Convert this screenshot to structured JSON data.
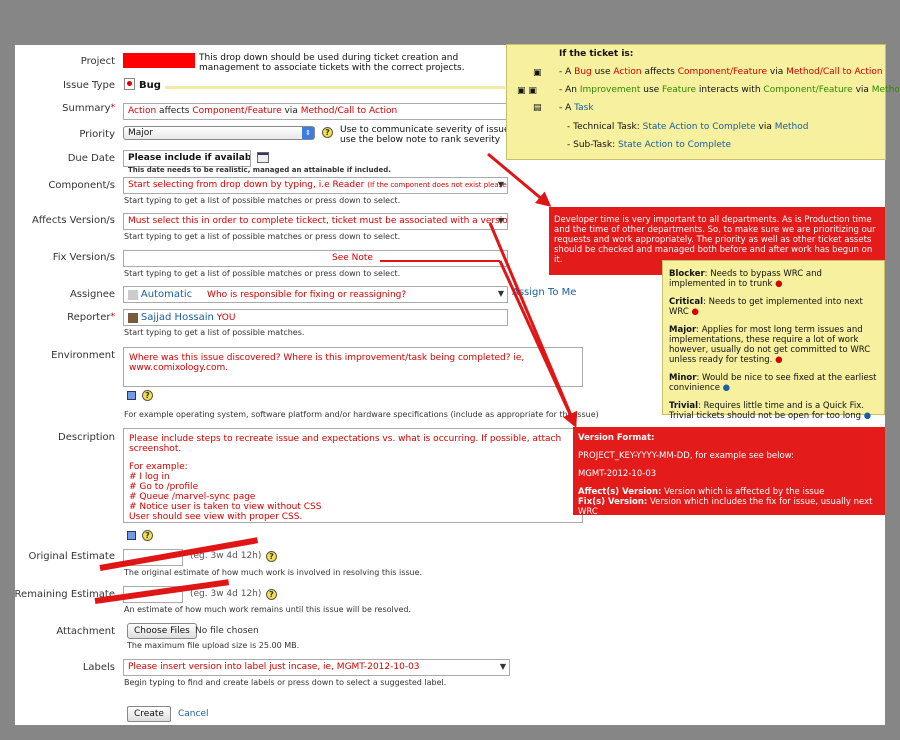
{
  "fields": {
    "project": {
      "label": "Project",
      "note": "This drop down should be used during ticket creation and management to associate tickets with the correct projects."
    },
    "issue_type": {
      "label": "Issue Type",
      "value": "Bug"
    },
    "summary": {
      "label": "Summary",
      "value_parts": [
        "Action",
        " affects ",
        "Component/Feature",
        " via ",
        "Method/Call to Action"
      ]
    },
    "priority": {
      "label": "Priority",
      "value": "Major",
      "note": "Use to communicate severity of issue; use the below note to rank severity"
    },
    "due_date": {
      "label": "Due Date",
      "value": "Please include if available.",
      "hint": "This date needs to be realistic, managed an attainable if included."
    },
    "components": {
      "label": "Component/s",
      "value": "Start selecting from drop down by typing, i.e Reader",
      "value_small": "(If the component does not exist please report)",
      "hint": "Start typing to get a list of possible matches or press down to select."
    },
    "affects_version": {
      "label": "Affects Version/s",
      "value": "Must select this in order to complete tickect, ticket must be associated with a version.",
      "hint": "Start typing to get a list of possible matches or press down to select."
    },
    "fix_version": {
      "label": "Fix Version/s",
      "value": "See Note",
      "hint": "Start typing to get a list of possible matches or press down to select."
    },
    "assignee": {
      "label": "Assignee",
      "value": "Automatic",
      "note": "Who is responsible for fixing or reassigning?",
      "link": "Assign To Me"
    },
    "reporter": {
      "label": "Reporter",
      "value": "Sajjad Hossain",
      "note": "YOU",
      "hint": "Start typing to get a list of possible matches."
    },
    "environment": {
      "label": "Environment",
      "value": "Where was this issue discovered? Where is this improvement/task being completed? ie, www.comixology.com.",
      "hint": "For example operating system, software platform and/or hardware specifications (include as appropriate for the issue)"
    },
    "description": {
      "label": "Description",
      "lines": [
        "Please include steps to recreate issue and expectations vs. what is occurring. If possible, attach screenshot.",
        "",
        "For example:",
        "# I log in",
        "# Go to /profile",
        "# Queue /marvel-sync page",
        "# Notice user is taken to view without CSS",
        "User should see view with proper CSS."
      ]
    },
    "original_estimate": {
      "label": "Original Estimate",
      "placeholder": "(eg. 3w 4d 12h)",
      "hint": "The original estimate of how much work is involved in resolving this issue."
    },
    "remaining_estimate": {
      "label": "Remaining Estimate",
      "placeholder": "(eg. 3w 4d 12h)",
      "hint": "An estimate of how much work remains until this issue will be resolved."
    },
    "attachment": {
      "label": "Attachment",
      "button": "Choose Files",
      "status": "No file chosen",
      "hint": "The maximum file upload size is 25.00 MB."
    },
    "labels": {
      "label": "Labels",
      "value": "Please insert version into label just incase, ie, MGMT-2012-10-03",
      "hint": "Begin typing to find and create labels or press down to select a suggested label."
    }
  },
  "actions": {
    "create": "Create",
    "cancel": "Cancel"
  },
  "ticket_note": {
    "title": "If the ticket is:",
    "bug": [
      "- A ",
      "Bug",
      " use ",
      "Action",
      " affects ",
      "Component/Feature",
      " via ",
      "Method/Call to Action"
    ],
    "improvement": [
      "- An ",
      "Improvement",
      " use ",
      "Feature",
      " interacts with ",
      "Component/Feature",
      " via ",
      "Method"
    ],
    "task": [
      "- A ",
      "Task"
    ],
    "technical": [
      "- Technical Task: ",
      "State Action to Complete",
      " via ",
      "Method"
    ],
    "subtask": [
      "- Sub-Task: ",
      "State Action to Complete"
    ]
  },
  "dev_note": "Developer time is very important to all departments. As is Production time and the time of other departments. So, to make sure we are prioritizing our requests and work appropriately. The priority as well as other ticket assets should be checked and managed both before and after work has begun on it.",
  "severity": [
    {
      "name": "Blocker",
      "text": ": Needs to bypass WRC and implemented in to trunk"
    },
    {
      "name": "Critical",
      "text": ": Needs to get implemented into next WRC"
    },
    {
      "name": "Major",
      "text": ": Applies for most long term issues and implementations, these require  a lot of work however, usually do not get committed to WRC unless ready for testing."
    },
    {
      "name": "Minor",
      "text": ": Would be nice to see fixed at the earliest convinience"
    },
    {
      "name": "Trivial",
      "text": ": Requires little time and is a Quick Fix. Trivial tickets should not be open for too long"
    }
  ],
  "version_note": {
    "title": "Version Format:",
    "format": "PROJECT_KEY-YYYY-MM-DD, for example see below:",
    "example": "MGMT-2012-10-03",
    "affects": [
      "Affect(s) Version:",
      " Version which is affected by the issue"
    ],
    "fixes": [
      "Fix(s) Version:",
      " Version which includes the fix for issue, usually next WRC"
    ]
  },
  "colors": {
    "note_red": "#e41b1b",
    "note_yellow": "#f6f09f",
    "text_red": "#d40000",
    "background": "#868686"
  }
}
